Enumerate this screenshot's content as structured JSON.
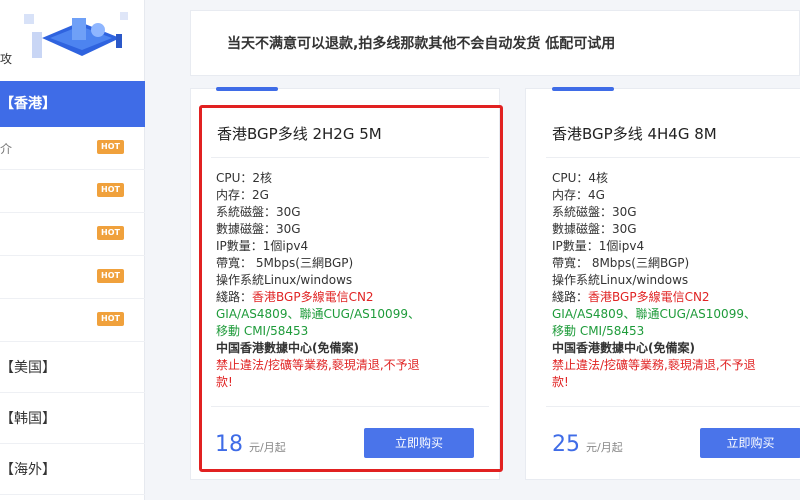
{
  "sidebar": {
    "top_text": "攻",
    "active_item": "【香港】",
    "sub_items": [
      {
        "label": "介",
        "badge": "HOT"
      },
      {
        "label": "",
        "badge": "HOT"
      },
      {
        "label": "",
        "badge": "HOT"
      },
      {
        "label": "",
        "badge": "HOT"
      },
      {
        "label": "",
        "badge": "HOT"
      }
    ],
    "regions": [
      "【美国】",
      "【韩国】",
      "【海外】"
    ]
  },
  "notice": "当天不满意可以退款,拍多线那款其他不会自动发货 低配可试用",
  "cards": [
    {
      "title": "香港BGP多线 2H2G 5M",
      "cpu": "CPU：2核",
      "ram": "内存：2G",
      "sys_disk": "系統磁盤：30G",
      "data_disk": "數據磁盤：30G",
      "ip": "IP數量：1個ipv4",
      "bandwidth": "帶寬：  5Mbps(三網BGP)",
      "os": "操作系統Linux/windows",
      "line_label": "綫路：",
      "line_red": "香港BGP多線電信CN2",
      "line_green1": "GIA/AS4809、聯通CUG/AS10099、",
      "line_green2": "移動 CMI/58453",
      "datacenter": "中国香港數據中心(免備案)",
      "warning1": "禁止違法/挖礦等業務,褻現清退,不予退",
      "warning2": "款!",
      "price": "18",
      "price_unit": "元/月起",
      "buy_label": "立即购买"
    },
    {
      "title": "香港BGP多线 4H4G 8M",
      "cpu": "CPU：4核",
      "ram": "内存：4G",
      "sys_disk": "系統磁盤：30G",
      "data_disk": "數據磁盤：30G",
      "ip": "IP數量：1個ipv4",
      "bandwidth": "帶寬：  8Mbps(三網BGP)",
      "os": "操作系統Linux/windows",
      "line_label": "綫路：",
      "line_red": "香港BGP多線電信CN2",
      "line_green1": "GIA/AS4809、聯通CUG/AS10099、",
      "line_green2": "移動 CMI/58453",
      "datacenter": "中国香港數據中心(免備案)",
      "warning1": "禁止違法/挖礦等業務,褻現清退,不予退",
      "warning2": "款!",
      "price": "25",
      "price_unit": "元/月起",
      "buy_label": "立即购买"
    }
  ],
  "colors": {
    "accent": "#3f6ce7",
    "red": "#e02424",
    "green": "#1e9b3a",
    "highlight": "#e12121",
    "hot_badge": "#f0a13c"
  }
}
